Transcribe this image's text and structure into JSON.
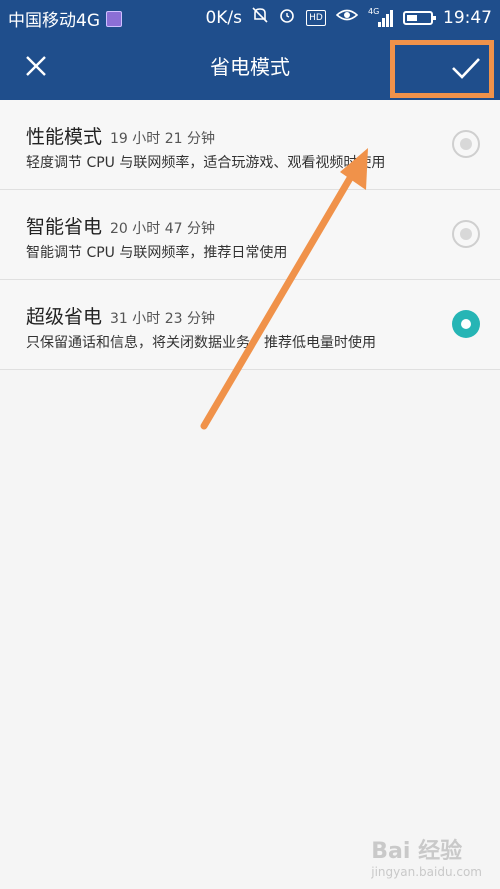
{
  "status_bar": {
    "carrier": "中国移动4G",
    "speed": "0K/s",
    "network": "4G",
    "time": "19:47",
    "icons": [
      "image-icon",
      "mute-icon",
      "alarm-icon",
      "hd-icon",
      "eye-icon",
      "signal-icon",
      "battery-icon"
    ],
    "battery_level": 0.45
  },
  "header": {
    "title": "省电模式",
    "close_icon": "close-icon",
    "confirm_icon": "check-icon",
    "highlight_color": "#f0924a",
    "background_color": "#1f4e8c"
  },
  "modes": [
    {
      "name": "性能模式",
      "time": "19 小时 21 分钟",
      "description": "轻度调节 CPU 与联网频率，适合玩游戏、观看视频时使用",
      "selected": false
    },
    {
      "name": "智能省电",
      "time": "20 小时 47 分钟",
      "description": "智能调节 CPU 与联网频率，推荐日常使用",
      "selected": false
    },
    {
      "name": "超级省电",
      "time": "31 小时 23 分钟",
      "description": "只保留通话和信息，将关闭数据业务，推荐低电量时使用",
      "selected": true
    }
  ],
  "accent_color": "#26b5b5",
  "watermark": {
    "text": "Bai 经验",
    "sub": "jingyan.baidu.com"
  }
}
